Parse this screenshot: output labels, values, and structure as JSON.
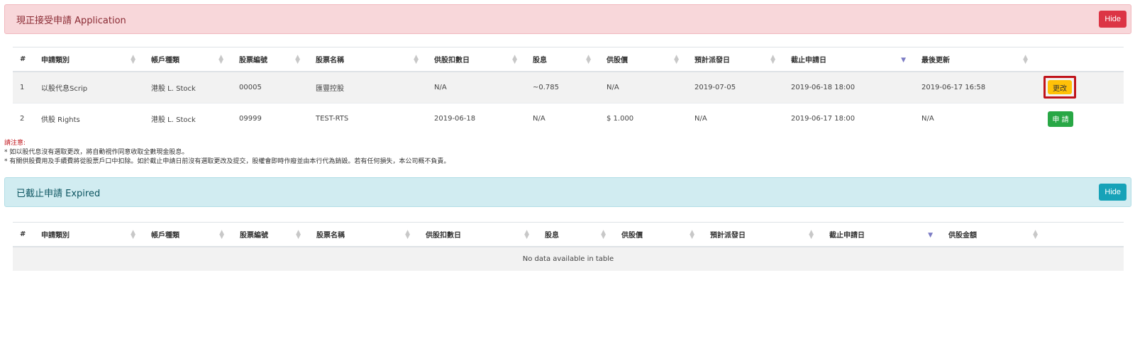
{
  "application_panel": {
    "title": "現正接受申請 Application",
    "hide_label": "Hide"
  },
  "application_table": {
    "headers": [
      "#",
      "申請類別",
      "帳戶種類",
      "股票編號",
      "股票名稱",
      "供股扣數日",
      "股息",
      "供股價",
      "預計派發日",
      "截止申請日",
      "最後更新",
      ""
    ],
    "rows": [
      {
        "num": "1",
        "type": "以股代息Scrip",
        "account": "港股 L. Stock",
        "code": "00005",
        "name": "匯豐控股",
        "deduct_date": "N/A",
        "dividend": "~0.785",
        "price": "N/A",
        "dist_date": "2019-07-05",
        "deadline": "2019-06-18 18:00",
        "updated": "2019-06-17 16:58",
        "action": "更改"
      },
      {
        "num": "2",
        "type": "供股 Rights",
        "account": "港股 L. Stock",
        "code": "09999",
        "name": "TEST-RTS",
        "deduct_date": "2019-06-18",
        "dividend": "N/A",
        "price": "$ 1.000",
        "dist_date": "N/A",
        "deadline": "2019-06-17 18:00",
        "updated": "N/A",
        "action": "申 請"
      }
    ]
  },
  "notice": {
    "title": "請注意:",
    "lines": [
      "* 如以股代息沒有選取更改，將自動視作同意收取全數現金股息。",
      "* 有關供股費用及手續費將從股票戶口中扣除。如於截止申請日前沒有選取更改及提交，股權會即時作廢並由本行代為銷毀。若有任何損失，本公司概不負責。"
    ]
  },
  "expired_panel": {
    "title": "已截止申請 Expired",
    "hide_label": "Hide"
  },
  "expired_table": {
    "headers": [
      "#",
      "申請類別",
      "帳戶種類",
      "股票編號",
      "股票名稱",
      "供股扣數日",
      "股息",
      "供股價",
      "預計派發日",
      "截止申請日",
      "供股金額",
      ""
    ],
    "empty_text": "No data available in table"
  },
  "colors": {
    "danger": "#dc3545",
    "info": "#17a2b8",
    "warning": "#ffc107",
    "success": "#28a745",
    "highlight_frame": "#c0141b"
  },
  "icons": {
    "sort": "sort-both-icon",
    "sort_active": "sort-desc-icon"
  }
}
